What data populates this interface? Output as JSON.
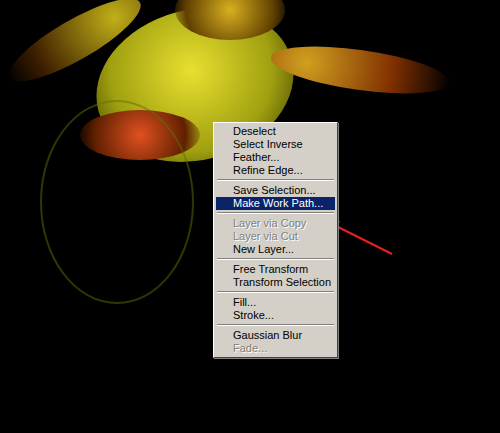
{
  "menu": {
    "groups": [
      [
        {
          "label": "Deselect",
          "selected": false,
          "disabled": false
        },
        {
          "label": "Select Inverse",
          "selected": false,
          "disabled": false
        },
        {
          "label": "Feather...",
          "selected": false,
          "disabled": false
        },
        {
          "label": "Refine Edge...",
          "selected": false,
          "disabled": false
        }
      ],
      [
        {
          "label": "Save Selection...",
          "selected": false,
          "disabled": false
        },
        {
          "label": "Make Work Path...",
          "selected": true,
          "disabled": false
        }
      ],
      [
        {
          "label": "Layer via Copy",
          "selected": false,
          "disabled": true
        },
        {
          "label": "Layer via Cut",
          "selected": false,
          "disabled": true
        },
        {
          "label": "New Layer...",
          "selected": false,
          "disabled": false
        }
      ],
      [
        {
          "label": "Free Transform",
          "selected": false,
          "disabled": false
        },
        {
          "label": "Transform Selection",
          "selected": false,
          "disabled": false
        }
      ],
      [
        {
          "label": "Fill...",
          "selected": false,
          "disabled": false
        },
        {
          "label": "Stroke...",
          "selected": false,
          "disabled": false
        }
      ],
      [
        {
          "label": "Gaussian Blur",
          "selected": false,
          "disabled": false
        },
        {
          "label": "Fade...",
          "selected": false,
          "disabled": true
        }
      ]
    ]
  }
}
